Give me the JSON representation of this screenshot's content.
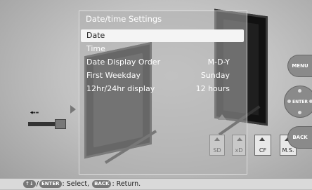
{
  "dialog": {
    "title": "Date/time Settings",
    "items": [
      {
        "label": "Date",
        "value": ""
      },
      {
        "label": "Time",
        "value": ""
      },
      {
        "label": "Date Display Order",
        "value": "M-D-Y"
      },
      {
        "label": "First Weekday",
        "value": "Sunday"
      },
      {
        "label": "12hr/24hr display",
        "value": "12 hours"
      }
    ],
    "selected_index": 0
  },
  "side_buttons": {
    "menu": "MENU",
    "enter": "ENTER",
    "back": "BACK"
  },
  "cards": {
    "sd": "SD",
    "xd": "xD",
    "cf": "CF",
    "ms": "M.S."
  },
  "footer": {
    "arrows": "↑↓",
    "enter_key": "ENTER",
    "select_text": ": Select, ",
    "back_key": "BACK",
    "return_text": ": Return."
  },
  "icons": {
    "usb": "usb-icon"
  },
  "colors": {
    "highlight": "#f4f4f4",
    "menu_text": "#ffffff",
    "bar_bg": "#d9d9d9"
  }
}
